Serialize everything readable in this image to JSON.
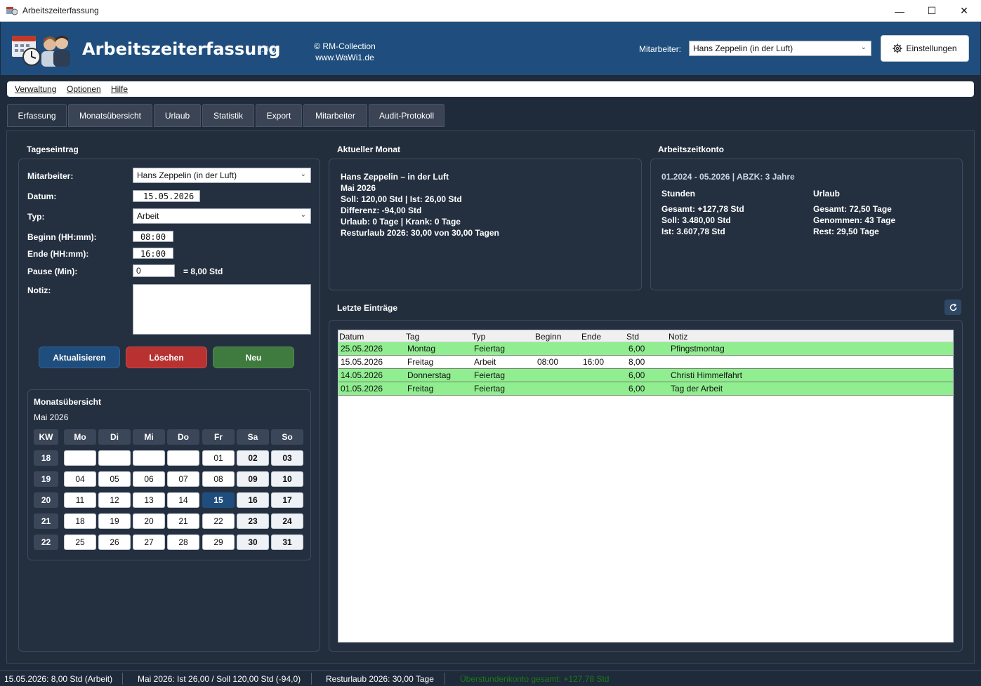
{
  "window": {
    "title": "Arbeitszeiterfassung",
    "minimize": "—",
    "maximize": "☐",
    "close": "✕"
  },
  "header": {
    "app_name": "Arbeitszeiterfassung",
    "version": "1.0.0",
    "copyright_line1": "© RM-Collection",
    "copyright_line2": "www.WaWi1.de",
    "employee_label": "Mitarbeiter:",
    "employee_value": "Hans Zeppelin (in der Luft)",
    "settings_label": "Einstellungen",
    "accent_color": "#1f4e7e"
  },
  "menu": {
    "items": [
      "Verwaltung",
      "Optionen",
      "Hilfe"
    ]
  },
  "tabs": [
    "Erfassung",
    "Monatsübersicht",
    "Urlaub",
    "Statistik",
    "Export",
    "Mitarbeiter",
    "Audit-Protokoll"
  ],
  "entry": {
    "title": "Tageseintrag",
    "employee_label": "Mitarbeiter:",
    "employee_value": "Hans Zeppelin (in der Luft)",
    "date_label": "Datum:",
    "date_value": "15.05.2026",
    "type_label": "Typ:",
    "type_value": "Arbeit",
    "start_label": "Beginn (HH:mm):",
    "start_value": "08:00",
    "end_label": "Ende (HH:mm):",
    "end_value": "16:00",
    "pause_label": "Pause (Min):",
    "pause_value": "0",
    "pause_result": "= 8,00 Std",
    "note_label": "Notiz:",
    "note_value": "",
    "btn_update": "Aktualisieren",
    "btn_delete": "Löschen",
    "btn_new": "Neu"
  },
  "calendar": {
    "title": "Monatsübersicht",
    "month": "Mai 2026",
    "headers": [
      "KW",
      "Mo",
      "Di",
      "Mi",
      "Do",
      "Fr",
      "Sa",
      "So"
    ],
    "weeks": [
      {
        "kw": "18",
        "days": [
          "",
          "",
          "",
          "",
          "01",
          "02",
          "03"
        ]
      },
      {
        "kw": "19",
        "days": [
          "04",
          "05",
          "06",
          "07",
          "08",
          "09",
          "10"
        ]
      },
      {
        "kw": "20",
        "days": [
          "11",
          "12",
          "13",
          "14",
          "15",
          "16",
          "17"
        ]
      },
      {
        "kw": "21",
        "days": [
          "18",
          "19",
          "20",
          "21",
          "22",
          "23",
          "24"
        ]
      },
      {
        "kw": "22",
        "days": [
          "25",
          "26",
          "27",
          "28",
          "29",
          "30",
          "31"
        ]
      }
    ],
    "selected_day": "15"
  },
  "current_month": {
    "title": "Aktueller Monat",
    "lines": [
      "Hans Zeppelin – in der Luft",
      "Mai 2026",
      "Soll: 120,00 Std  |  Ist: 26,00 Std",
      "Differenz: -94,00 Std",
      "Urlaub: 0 Tage  |  Krank: 0 Tage",
      "Resturlaub 2026: 30,00 von 30,00 Tagen"
    ]
  },
  "account": {
    "title": "Arbeitszeitkonto",
    "period": "01.2024 - 05.2026  |  ABZK: 3 Jahre",
    "hours_title": "Stunden",
    "hours_lines": [
      "Gesamt: +127,78 Std",
      "Soll: 3.480,00 Std",
      "Ist: 3.607,78 Std"
    ],
    "vacation_title": "Urlaub",
    "vacation_lines": [
      "Gesamt: 72,50 Tage",
      "Genommen: 43 Tage",
      "Rest: 29,50 Tage"
    ]
  },
  "recent": {
    "title": "Letzte Einträge",
    "refresh_icon": "refresh-icon",
    "columns": [
      "Datum",
      "Tag",
      "Typ",
      "Beginn",
      "Ende",
      "Std",
      "Notiz"
    ],
    "rows": [
      {
        "datum": "25.05.2026",
        "tag": "Montag",
        "typ": "Feiertag",
        "beginn": "",
        "ende": "",
        "std": "6,00",
        "notiz": "Pfingstmontag",
        "color": "#90ee90"
      },
      {
        "datum": "15.05.2026",
        "tag": "Freitag",
        "typ": "Arbeit",
        "beginn": "08:00",
        "ende": "16:00",
        "std": "8,00",
        "notiz": "",
        "color": "#ffffff"
      },
      {
        "datum": "14.05.2026",
        "tag": "Donnerstag",
        "typ": "Feiertag",
        "beginn": "",
        "ende": "",
        "std": "6,00",
        "notiz": "Christi Himmelfahrt",
        "color": "#90ee90"
      },
      {
        "datum": "01.05.2026",
        "tag": "Freitag",
        "typ": "Feiertag",
        "beginn": "",
        "ende": "",
        "std": "6,00",
        "notiz": "Tag der Arbeit",
        "color": "#90ee90"
      }
    ]
  },
  "status": {
    "item1": "15.05.2026: 8,00 Std (Arbeit)",
    "item2": "Mai 2026: Ist 26,00 / Soll 120,00 Std (-94,0)",
    "item3": "Resturlaub 2026: 30,00 Tage",
    "item4": "Überstundenkonto gesamt: +127,78 Std",
    "item4_color": "#1a7a1a"
  }
}
